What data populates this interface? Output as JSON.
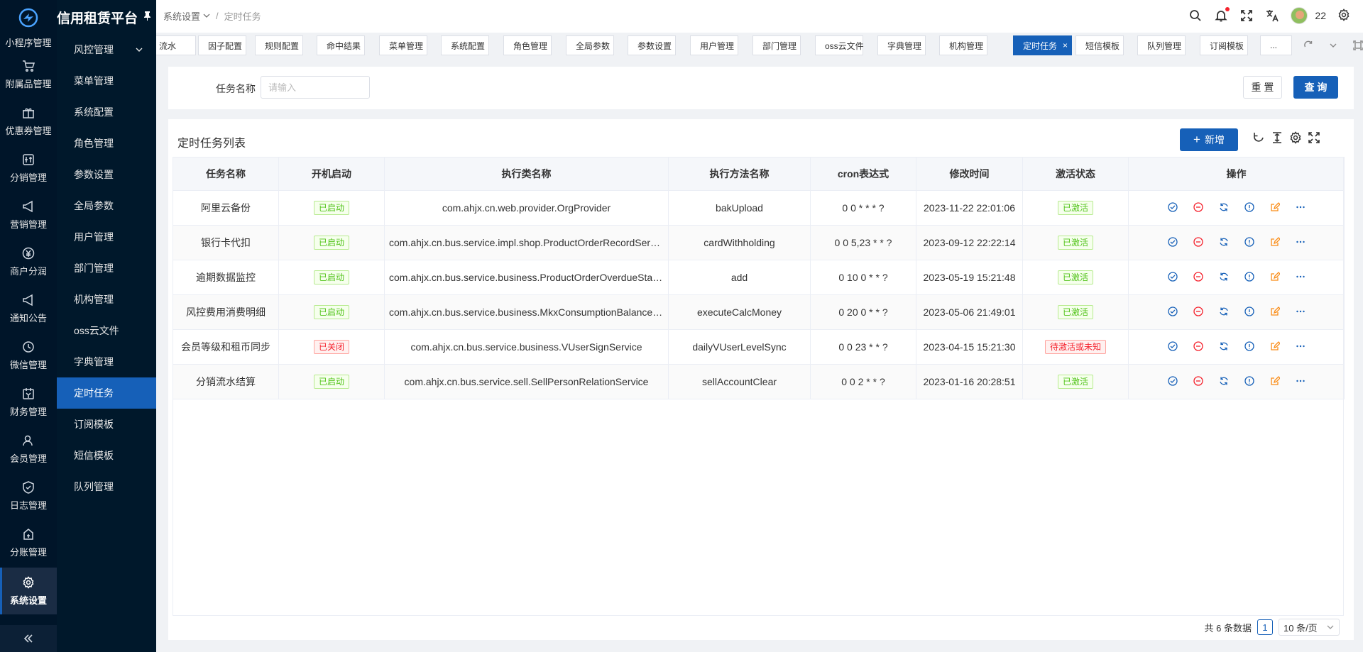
{
  "app": {
    "title": "信用租赁平台"
  },
  "rail": {
    "items": [
      {
        "label": "小程序管理",
        "icon": "mini-program-icon"
      },
      {
        "label": "附属品管理",
        "icon": "cart-icon"
      },
      {
        "label": "优惠券管理",
        "icon": "gift-icon"
      },
      {
        "label": "分销管理",
        "icon": "distribution-icon"
      },
      {
        "label": "营销管理",
        "icon": "megaphone-icon"
      },
      {
        "label": "商户分润",
        "icon": "yen-icon"
      },
      {
        "label": "通知公告",
        "icon": "notice-icon"
      },
      {
        "label": "微信管理",
        "icon": "wechat-icon"
      },
      {
        "label": "财务管理",
        "icon": "finance-icon"
      },
      {
        "label": "会员管理",
        "icon": "member-icon"
      },
      {
        "label": "日志管理",
        "icon": "shield-icon"
      },
      {
        "label": "分账管理",
        "icon": "split-icon"
      },
      {
        "label": "系统设置",
        "icon": "gear-icon"
      }
    ],
    "collapse_icon": "double-chevron-left-icon"
  },
  "submenu": {
    "items": [
      "风控管理",
      "菜单管理",
      "系统配置",
      "角色管理",
      "参数设置",
      "全局参数",
      "用户管理",
      "部门管理",
      "机构管理",
      "oss云文件",
      "字典管理",
      "定时任务",
      "订阅模板",
      "短信模板",
      "队列管理"
    ],
    "active_index": 11
  },
  "header": {
    "breadcrumb": [
      "系统设置",
      "定时任务"
    ],
    "username": "22",
    "icons": [
      "search-icon",
      "bell-icon",
      "fullscreen-icon",
      "translate-icon",
      "avatar",
      "gear-icon"
    ]
  },
  "tabs": {
    "items": [
      "流水",
      "因子配置",
      "规则配置",
      "命中结果",
      "菜单管理",
      "系统配置",
      "角色管理",
      "全局参数",
      "参数设置",
      "用户管理",
      "部门管理",
      "oss云文件",
      "字典管理",
      "机构管理",
      "定时任务",
      "短信模板",
      "队列管理",
      "订阅模板",
      "..."
    ],
    "active_index": 14,
    "close_glyph": "×"
  },
  "filter": {
    "label": "任务名称",
    "placeholder": "请输入",
    "reset_label": "重 置",
    "query_label": "查 询"
  },
  "table": {
    "title": "定时任务列表",
    "add_label": "新增",
    "add_glyph": "+",
    "columns": [
      "任务名称",
      "开机启动",
      "执行类名称",
      "执行方法名称",
      "cron表达式",
      "修改时间",
      "激活状态",
      "操作"
    ],
    "rows": [
      {
        "name": "阿里云备份",
        "boot": "已启动",
        "class": "com.ahjx.cn.web.provider.OrgProvider",
        "method": "bakUpload",
        "cron": "0 0 * * * ?",
        "time": "2023-11-22 22:01:06",
        "status": "已激活"
      },
      {
        "name": "银行卡代扣",
        "boot": "已启动",
        "class": "com.ahjx.cn.bus.service.impl.shop.ProductOrderRecordService",
        "method": "cardWithholding",
        "cron": "0 0 5,23 * * ?",
        "time": "2023-09-12 22:22:14",
        "status": "已激活"
      },
      {
        "name": "逾期数据监控",
        "boot": "已启动",
        "class": "com.ahjx.cn.bus.service.business.ProductOrderOverdueStatis...",
        "method": "add",
        "cron": "0 10 0 * * ?",
        "time": "2023-05-19 15:21:48",
        "status": "已激活"
      },
      {
        "name": "风控费用消费明细",
        "boot": "已启动",
        "class": "com.ahjx.cn.bus.service.business.MkxConsumptionBalanceSe...",
        "method": "executeCalcMoney",
        "cron": "0 20 0 * * ?",
        "time": "2023-05-06 21:49:01",
        "status": "已激活"
      },
      {
        "name": "会员等级和租币同步",
        "boot": "已关闭",
        "class": "com.ahjx.cn.bus.service.business.VUserSignService",
        "method": "dailyVUserLevelSync",
        "cron": "0 0 23 * * ?",
        "time": "2023-04-15 15:21:30",
        "status": "待激活或未知"
      },
      {
        "name": "分销流水结算",
        "boot": "已启动",
        "class": "com.ahjx.cn.bus.service.sell.SellPersonRelationService",
        "method": "sellAccountClear",
        "cron": "0 0 2 * * ?",
        "time": "2023-01-16 20:28:51",
        "status": "已激活"
      }
    ],
    "row_actions": [
      "check-circle-icon",
      "minus-circle-icon",
      "sync-icon",
      "info-circle-icon",
      "edit-icon",
      "more-icon"
    ],
    "toolbar_icons": [
      "refresh-icon",
      "column-height-icon",
      "setting-icon",
      "fullscreen-icon"
    ]
  },
  "pagination": {
    "total_text": "共 6 条数据",
    "current_page": "1",
    "page_size": "10 条/页"
  },
  "colors": {
    "primary": "#1660b8",
    "sidebar": "#001529",
    "success": "#52c41a",
    "danger": "#f5222d",
    "warning": "#fa8c16"
  }
}
